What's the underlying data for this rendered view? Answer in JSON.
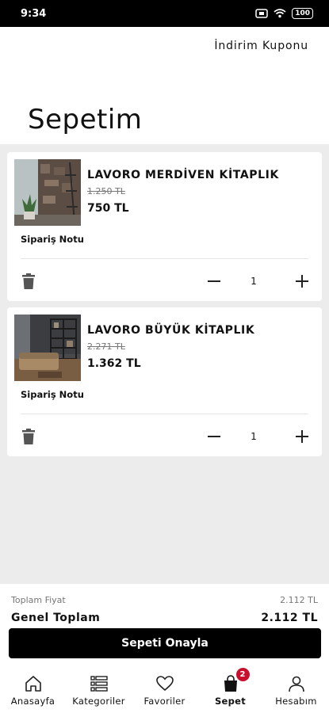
{
  "status_bar": {
    "time": "9:34",
    "battery": "100",
    "icons": [
      "sim-icon",
      "wifi-icon",
      "battery-icon"
    ]
  },
  "header": {
    "coupon_link": "İndirim Kuponu",
    "title": "Sepetim"
  },
  "cart": {
    "items": [
      {
        "name": "LAVORO MERDİVEN KİTAPLIK",
        "old_price": "1.250 TL",
        "price": "750 TL",
        "note_label": "Sipariş Notu",
        "quantity": "1"
      },
      {
        "name": "LAVORO BÜYÜK KİTAPLIK",
        "old_price": "2.271 TL",
        "price": "1.362 TL",
        "note_label": "Sipariş Notu",
        "quantity": "1"
      }
    ]
  },
  "summary": {
    "subtotal_label": "Toplam Fiyat",
    "subtotal_value": "2.112 TL",
    "total_label": "Genel Toplam",
    "total_value": "2.112 TL",
    "confirm_label": "Sepeti Onayla"
  },
  "tabbar": {
    "items": [
      {
        "label": "Anasayfa",
        "icon": "home-icon"
      },
      {
        "label": "Kategoriler",
        "icon": "list-icon"
      },
      {
        "label": "Favoriler",
        "icon": "heart-icon"
      },
      {
        "label": "Sepet",
        "icon": "bag-icon",
        "badge": "2",
        "active": true
      },
      {
        "label": "Hesabım",
        "icon": "user-icon"
      }
    ]
  },
  "colors": {
    "background": "#ececec",
    "primary": "#000000",
    "badge": "#c8102e",
    "muted_text": "#777777"
  }
}
